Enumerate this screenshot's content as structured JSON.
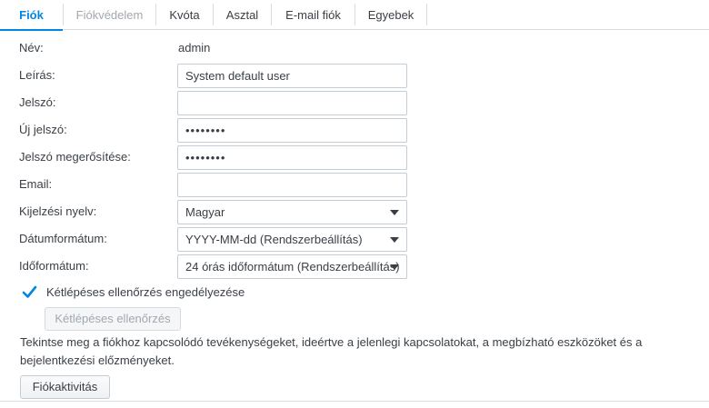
{
  "tabs": [
    {
      "label": "Fiók",
      "state": "active"
    },
    {
      "label": "Fiókvédelem",
      "state": "disabled"
    },
    {
      "label": "Kvóta",
      "state": "normal"
    },
    {
      "label": "Asztal",
      "state": "normal"
    },
    {
      "label": "E-mail fiók",
      "state": "normal"
    },
    {
      "label": "Egyebek",
      "state": "normal"
    }
  ],
  "form": {
    "name_label": "Név:",
    "name_value": "admin",
    "description_label": "Leírás:",
    "description_value": "System default user",
    "password_label": "Jelszó:",
    "password_value": "",
    "new_password_label": "Új jelszó:",
    "new_password_value": "••••••••",
    "confirm_password_label": "Jelszó megerősítése:",
    "confirm_password_value": "••••••••",
    "email_label": "Email:",
    "email_value": "",
    "language_label": "Kijelzési nyelv:",
    "language_value": "Magyar",
    "date_format_label": "Dátumformátum:",
    "date_format_value": "YYYY-MM-dd (Rendszerbeállítás)",
    "time_format_label": "Időformátum:",
    "time_format_value": "24 órás időformátum (Rendszerbeállítás)"
  },
  "two_step": {
    "checkbox_label": "Kétlépéses ellenőrzés engedélyezése",
    "checked": true,
    "button_label": "Kétlépéses ellenőrzés"
  },
  "activity": {
    "description": "Tekintse meg a fiókhoz kapcsolódó tevékenységeket, ideértve a jelenlegi kapcsolatokat, a megbízható eszközöket és a bejelentkezési előzményeket.",
    "button_label": "Fiókaktivitás"
  },
  "colors": {
    "accent": "#0086e5",
    "text": "#3a3f45",
    "disabled_text": "#a2a8ae",
    "border": "#c4ccd4"
  }
}
